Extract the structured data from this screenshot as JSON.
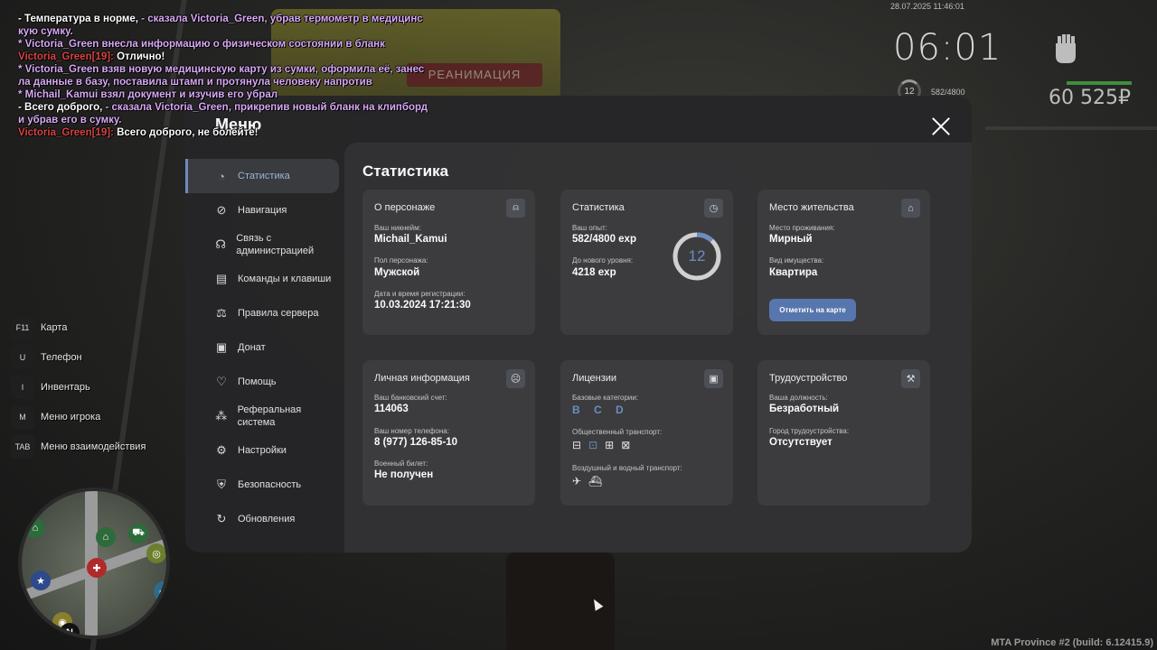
{
  "chat": [
    {
      "parts": [
        {
          "c": "white",
          "t": "- Температура в норме, "
        },
        {
          "c": "purple",
          "t": "- сказала Victoria_Green, убрав термометр в медицинс"
        }
      ]
    },
    {
      "parts": [
        {
          "c": "purple",
          "t": "кую сумку."
        }
      ]
    },
    {
      "parts": [
        {
          "c": "purple",
          "t": "* Victoria_Green внесла информацию о физическом состоянии в бланк"
        }
      ]
    },
    {
      "parts": [
        {
          "c": "red",
          "t": "Victoria_Green[19]: "
        },
        {
          "c": "white",
          "t": "Отлично!"
        }
      ]
    },
    {
      "parts": [
        {
          "c": "purple",
          "t": "* Victoria_Green взяв новую медицинскую карту из сумки, оформила её, занес"
        }
      ]
    },
    {
      "parts": [
        {
          "c": "purple",
          "t": "ла данные в базу, поставила штамп и протянула человеку напротив"
        }
      ]
    },
    {
      "parts": [
        {
          "c": "purple",
          "t": "* Michail_Kamui взял документ и изучив его убрал"
        }
      ]
    },
    {
      "parts": [
        {
          "c": "white",
          "t": "- Всего доброго, "
        },
        {
          "c": "purple",
          "t": "- сказала Victoria_Green, прикрепив новый бланк на клипборд"
        }
      ]
    },
    {
      "parts": [
        {
          "c": "purple",
          "t": " и убрав его в сумку."
        }
      ]
    },
    {
      "parts": [
        {
          "c": "red",
          "t": "Victoria_Green[19]: "
        },
        {
          "c": "white",
          "t": "Всего доброго, не болейте!"
        }
      ]
    }
  ],
  "hud": {
    "datetime": "28.07.2025 11:46:01",
    "clock": "06:01",
    "level": "12",
    "exp": "582/4800",
    "money": "60 525₽"
  },
  "scene": {
    "ambulance_text": "РЕАНИМАЦИЯ"
  },
  "keys": [
    {
      "key": "F11",
      "label": "Карта"
    },
    {
      "key": "U",
      "label": "Телефон"
    },
    {
      "key": "I",
      "label": "Инвентарь"
    },
    {
      "key": "M",
      "label": "Меню игрока"
    },
    {
      "key": "TAB",
      "label": "Меню взаимодействия"
    }
  ],
  "build": "MTA Province #2 (build: 6.12415.9)",
  "menu": {
    "title": "Меню",
    "content_title": "Статистика",
    "nav": [
      {
        "label": "Статистика",
        "icon": "pie-chart-icon",
        "glyph": "◔",
        "active": true
      },
      {
        "label": "Навигация",
        "icon": "compass-icon",
        "glyph": "⊘"
      },
      {
        "label": "Связь с администрацией",
        "icon": "headset-icon",
        "glyph": "☊"
      },
      {
        "label": "Команды и клавиши",
        "icon": "document-icon",
        "glyph": "▤"
      },
      {
        "label": "Правила сервера",
        "icon": "scales-icon",
        "glyph": "⚖"
      },
      {
        "label": "Донат",
        "icon": "wallet-icon",
        "glyph": "▣"
      },
      {
        "label": "Помощь",
        "icon": "heart-hands-icon",
        "glyph": "♡"
      },
      {
        "label": "Реферальная система",
        "icon": "network-icon",
        "glyph": "⁂"
      },
      {
        "label": "Настройки",
        "icon": "gear-icon",
        "glyph": "⚙"
      },
      {
        "label": "Безопасность",
        "icon": "shield-icon",
        "glyph": "⛨"
      },
      {
        "label": "Обновления",
        "icon": "refresh-icon",
        "glyph": "↻"
      }
    ],
    "cards": {
      "character": {
        "title": "О персонаже",
        "nickname_label": "Ваш никнейм:",
        "nickname": "Michail_Kamui",
        "gender_label": "Пол персонажа:",
        "gender": "Мужской",
        "reg_label": "Дата и время регистрации:",
        "reg": "10.03.2024 17:21:30"
      },
      "stats": {
        "title": "Статистика",
        "exp_label": "Ваш опыт:",
        "exp": "582/4800 exp",
        "next_label": "До нового уровня:",
        "next": "4218 exp",
        "level": "12",
        "level_progress": 0.12
      },
      "residence": {
        "title": "Место жительства",
        "place_label": "Место проживания:",
        "place": "Мирный",
        "property_label": "Вид имущества:",
        "property": "Квартира",
        "button": "Отметить на карте"
      },
      "personal": {
        "title": "Личная информация",
        "bank_label": "Ваш банковский счет:",
        "bank": "114063",
        "phone_label": "Ваш номер телефона:",
        "phone": "8 (977) 126-85-10",
        "military_label": "Военный билет:",
        "military": "Не получен"
      },
      "licenses": {
        "title": "Лицензии",
        "base_label": "Базовые категории:",
        "base": "B C D",
        "public_label": "Общественный транспорт:",
        "air_label": "Воздушный и водный транспорт:"
      },
      "job": {
        "title": "Трудоустройство",
        "position_label": "Ваша должность:",
        "position": "Безработный",
        "city_label": "Город трудоустройства:",
        "city": "Отсутствует"
      }
    }
  }
}
